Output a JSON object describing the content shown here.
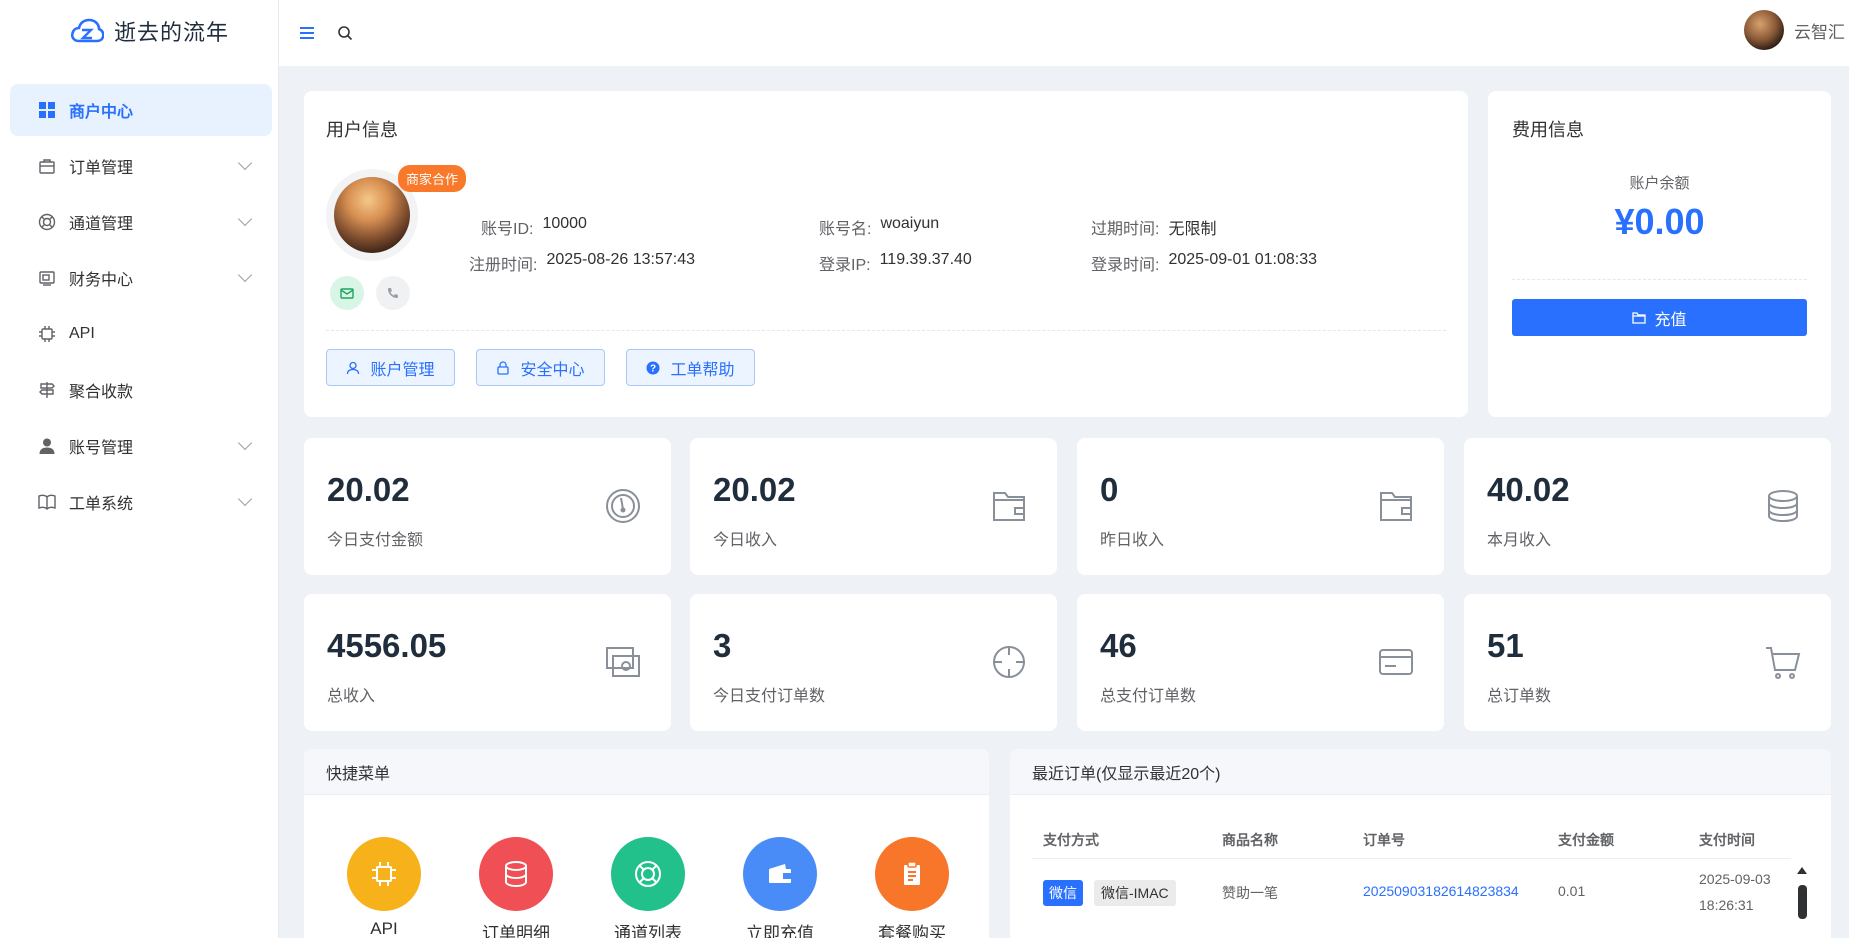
{
  "app": {
    "name": "逝去的流年",
    "user_name": "云智汇"
  },
  "sidebar": {
    "items": [
      {
        "label": "商户中心",
        "active": true,
        "icon": "grid-icon"
      },
      {
        "label": "订单管理",
        "icon": "bag-icon"
      },
      {
        "label": "通道管理",
        "icon": "lifebuoy-icon"
      },
      {
        "label": "财务中心",
        "icon": "finance-icon"
      },
      {
        "label": "API",
        "icon": "chip-icon"
      },
      {
        "label": "聚合收款",
        "icon": "signpost-icon"
      },
      {
        "label": "账号管理",
        "icon": "person-icon"
      },
      {
        "label": "工单系统",
        "icon": "book-icon"
      }
    ]
  },
  "user_info": {
    "title": "用户信息",
    "badge": "商家合作",
    "fields": [
      {
        "label": "账号ID:",
        "value": "10000"
      },
      {
        "label": "账号名:",
        "value": "woaiyun"
      },
      {
        "label": "过期时间:",
        "value": "无限制"
      },
      {
        "label": "注册时间:",
        "value": "2025-08-26 13:57:43"
      },
      {
        "label": "登录IP:",
        "value": "119.39.37.40"
      },
      {
        "label": "登录时间:",
        "value": "2025-09-01 01:08:33"
      }
    ],
    "buttons": [
      "账户管理",
      "安全中心",
      "工单帮助"
    ]
  },
  "fee_info": {
    "title": "费用信息",
    "balance_label": "账户余额",
    "balance": "¥0.00",
    "recharge": "充值"
  },
  "stats": [
    {
      "value": "20.02",
      "label": "今日支付金额",
      "icon": "gauge-icon"
    },
    {
      "value": "20.02",
      "label": "今日收入",
      "icon": "wallet-icon"
    },
    {
      "value": "0",
      "label": "昨日收入",
      "icon": "wallet-icon"
    },
    {
      "value": "40.02",
      "label": "本月收入",
      "icon": "coins-icon"
    },
    {
      "value": "4556.05",
      "label": "总收入",
      "icon": "cash-icon"
    },
    {
      "value": "3",
      "label": "今日支付订单数",
      "icon": "crosshair-icon"
    },
    {
      "value": "46",
      "label": "总支付订单数",
      "icon": "card-icon"
    },
    {
      "value": "51",
      "label": "总订单数",
      "icon": "basket-icon"
    }
  ],
  "quick_menu": {
    "title": "快捷菜单",
    "items": [
      {
        "label": "API",
        "color": "#f7b21b"
      },
      {
        "label": "订单明细",
        "color": "#ef4f55"
      },
      {
        "label": "通道列表",
        "color": "#22c08b"
      },
      {
        "label": "立即充值",
        "color": "#4a8cf7"
      },
      {
        "label": "套餐购买",
        "color": "#f7762a"
      }
    ]
  },
  "recent_orders": {
    "title": "最近订单(仅显示最近20个)",
    "columns": [
      "支付方式",
      "商品名称",
      "订单号",
      "支付金额",
      "支付时间"
    ],
    "rows": [
      {
        "pay_tag": "微信",
        "channel": "微信-IMAC",
        "product": "赞助一笔",
        "order_no": "20250903182614823834",
        "amount": "0.01",
        "time_date": "2025-09-03",
        "time_clock": "18:26:31"
      }
    ]
  },
  "colors": {
    "primary": "#2970ff",
    "badge": "#f8792a",
    "background": "#eef1f6"
  }
}
